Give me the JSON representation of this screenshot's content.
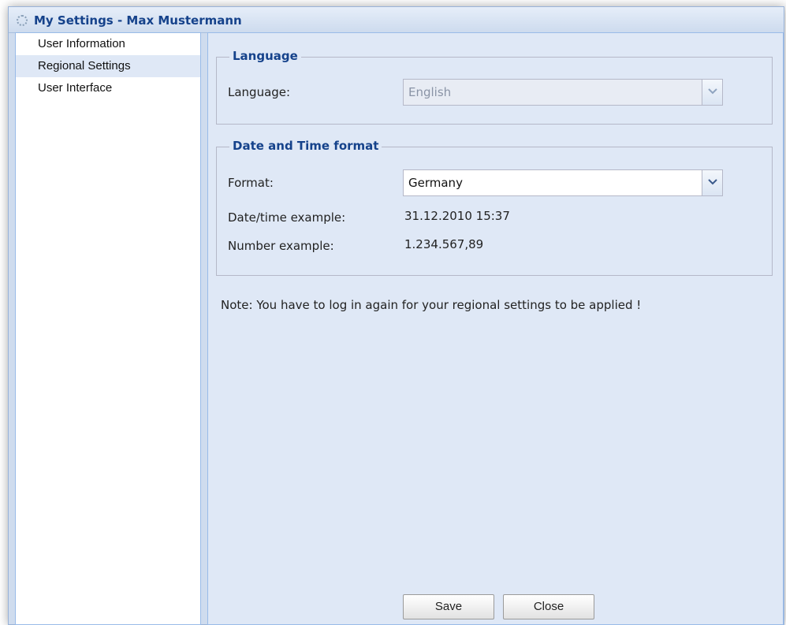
{
  "window": {
    "title": "My Settings - Max Mustermann",
    "title_icon": "gear-icon"
  },
  "sidebar": {
    "items": [
      {
        "label": "User Information",
        "selected": false
      },
      {
        "label": "Regional Settings",
        "selected": true
      },
      {
        "label": "User Interface",
        "selected": false
      }
    ]
  },
  "language_section": {
    "legend": "Language",
    "language_label": "Language:",
    "language_value": "English",
    "language_disabled": true
  },
  "datetime_section": {
    "legend": "Date and Time format",
    "format_label": "Format:",
    "format_value": "Germany",
    "date_example_label": "Date/time example:",
    "date_example_value": "31.12.2010 15:37",
    "number_example_label": "Number example:",
    "number_example_value": "1.234.567,89"
  },
  "note": "Note: You have to log in again for your regional settings to be applied !",
  "buttons": {
    "save": "Save",
    "close": "Close"
  },
  "colors": {
    "accent": "#15428b",
    "panel_bg": "#dfe8f6",
    "border": "#99bbe8"
  }
}
